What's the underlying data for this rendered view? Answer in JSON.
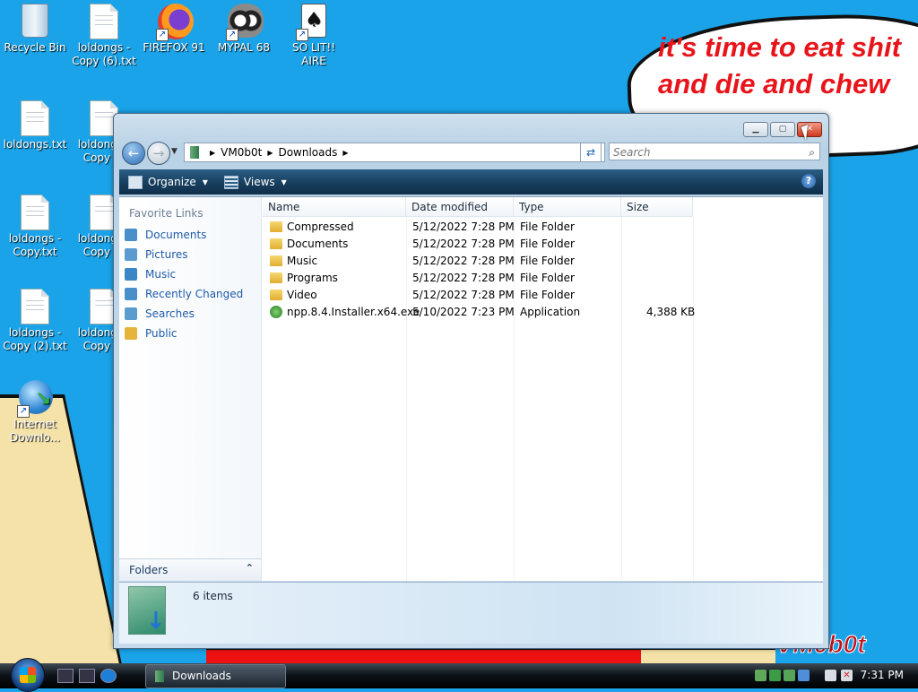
{
  "desktop": {
    "icons": [
      {
        "label": "Recycle Bin"
      },
      {
        "label": "loldongs - Copy (6).txt"
      },
      {
        "label": "FIREFOX 91"
      },
      {
        "label": "MYPAL 68"
      },
      {
        "label": "SO LIT!! AIRE"
      },
      {
        "label": "loldongs.txt"
      },
      {
        "label": "loldongs - Copy (7"
      },
      {
        "label": "loldongs - Copy.txt"
      },
      {
        "label": "loldongs - Copy (8"
      },
      {
        "label": "loldongs - Copy (2).txt"
      },
      {
        "label": "loldongs - Copy (9"
      },
      {
        "label": "Internet Downlo..."
      }
    ],
    "wallpaper_text": "it's time to eat shit and die and chew",
    "wallpaper_watermark": "VM0b0t"
  },
  "window": {
    "breadcrumb": [
      "VM0b0t",
      "Downloads"
    ],
    "search_placeholder": "Search",
    "toolbar": {
      "organize": "Organize",
      "views": "Views"
    },
    "favorite_links_title": "Favorite Links",
    "favorite_links": [
      {
        "label": "Documents",
        "color": "#4a8fc9"
      },
      {
        "label": "Pictures",
        "color": "#5b9cd0"
      },
      {
        "label": "Music",
        "color": "#3b86c4"
      },
      {
        "label": "Recently Changed",
        "color": "#4a8fc9"
      },
      {
        "label": "Searches",
        "color": "#5b9cd0"
      },
      {
        "label": "Public",
        "color": "#e6b43a"
      }
    ],
    "folders_label": "Folders",
    "columns": {
      "name": "Name",
      "date": "Date modified",
      "type": "Type",
      "size": "Size"
    },
    "files": [
      {
        "name": "Compressed",
        "date": "5/12/2022 7:28 PM",
        "type": "File Folder",
        "size": "",
        "icon": "folder-icon"
      },
      {
        "name": "Documents",
        "date": "5/12/2022 7:28 PM",
        "type": "File Folder",
        "size": "",
        "icon": "folder-icon"
      },
      {
        "name": "Music",
        "date": "5/12/2022 7:28 PM",
        "type": "File Folder",
        "size": "",
        "icon": "folder-icon"
      },
      {
        "name": "Programs",
        "date": "5/12/2022 7:28 PM",
        "type": "File Folder",
        "size": "",
        "icon": "folder-icon"
      },
      {
        "name": "Video",
        "date": "5/12/2022 7:28 PM",
        "type": "File Folder",
        "size": "",
        "icon": "folder-icon"
      },
      {
        "name": "npp.8.4.Installer.x64.exe",
        "date": "5/10/2022 7:23 PM",
        "type": "Application",
        "size": "4,388 KB",
        "icon": "application-icon"
      }
    ],
    "item_count": "6 items"
  },
  "taskbar": {
    "task_label": "Downloads",
    "clock": "7:31 PM"
  }
}
